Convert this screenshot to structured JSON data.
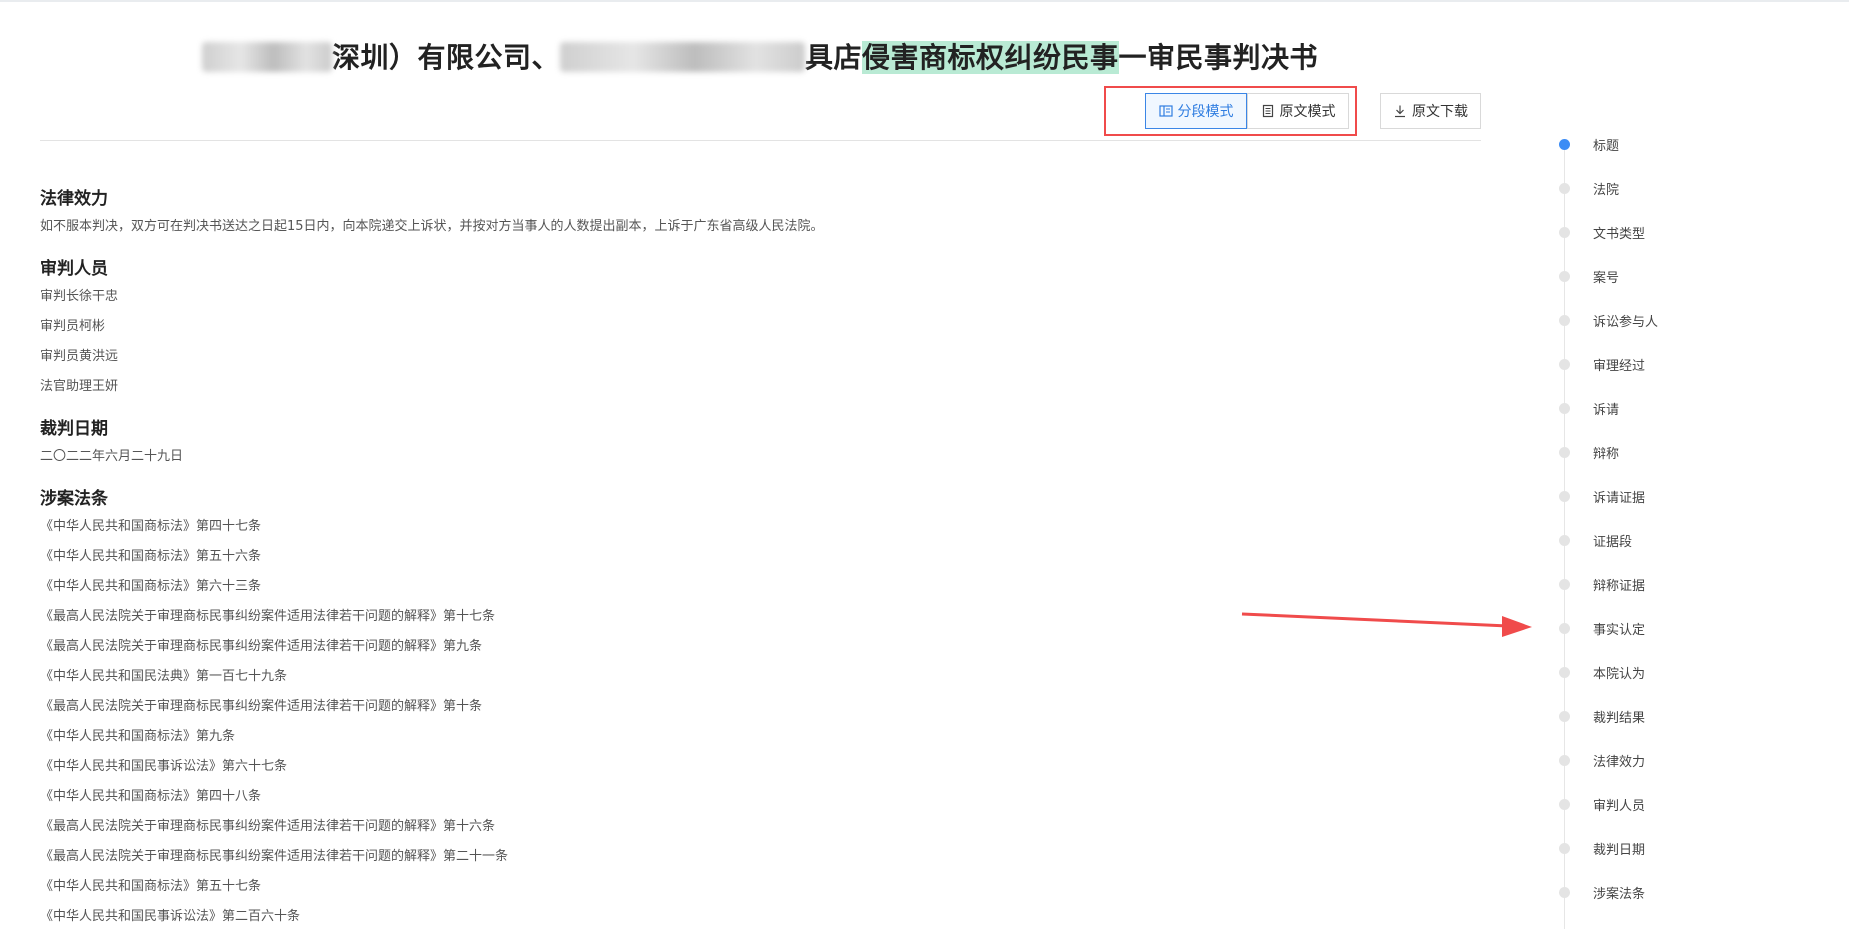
{
  "title": {
    "part1": "深圳）有限公司、",
    "part2": "具店",
    "highlight": "侵害商标权纠纷民事",
    "part3": "一审民事判决书"
  },
  "toolbar": {
    "segment_mode": "分段模式",
    "original_mode": "原文模式",
    "download": "原文下载"
  },
  "sections": {
    "legal_effect": {
      "heading": "法律效力",
      "text": "如不服本判决，双方可在判决书送达之日起15日内，向本院递交上诉状，并按对方当事人的人数提出副本，上诉于广东省高级人民法院。"
    },
    "judges": {
      "heading": "审判人员",
      "lines": [
        "审判长徐干忠",
        "审判员柯彬",
        "审判员黄洪远",
        "法官助理王妍"
      ]
    },
    "date": {
      "heading": "裁判日期",
      "text": "二〇二二年六月二十九日"
    },
    "laws": {
      "heading": "涉案法条",
      "lines": [
        "《中华人民共和国商标法》第四十七条",
        "《中华人民共和国商标法》第五十六条",
        "《中华人民共和国商标法》第六十三条",
        "《最高人民法院关于审理商标民事纠纷案件适用法律若干问题的解释》第十七条",
        "《最高人民法院关于审理商标民事纠纷案件适用法律若干问题的解释》第九条",
        "《中华人民共和国民法典》第一百七十九条",
        "《最高人民法院关于审理商标民事纠纷案件适用法律若干问题的解释》第十条",
        "《中华人民共和国商标法》第九条",
        "《中华人民共和国民事诉讼法》第六十七条",
        "《中华人民共和国商标法》第四十八条",
        "《最高人民法院关于审理商标民事纠纷案件适用法律若干问题的解释》第十六条",
        "《最高人民法院关于审理商标民事纠纷案件适用法律若干问题的解释》第二十一条",
        "《中华人民共和国商标法》第五十七条",
        "《中华人民共和国民事诉讼法》第二百六十条"
      ]
    }
  },
  "toc": {
    "active_index": 0,
    "items": [
      "标题",
      "法院",
      "文书类型",
      "案号",
      "诉讼参与人",
      "审理经过",
      "诉请",
      "辩称",
      "诉请证据",
      "证据段",
      "辩称证据",
      "事实认定",
      "本院认为",
      "裁判结果",
      "法律效力",
      "审判人员",
      "裁判日期",
      "涉案法条"
    ]
  },
  "colors": {
    "accent": "#2f7de1",
    "highlight": "#b9ead4",
    "annotation_red": "#f04b4b"
  }
}
